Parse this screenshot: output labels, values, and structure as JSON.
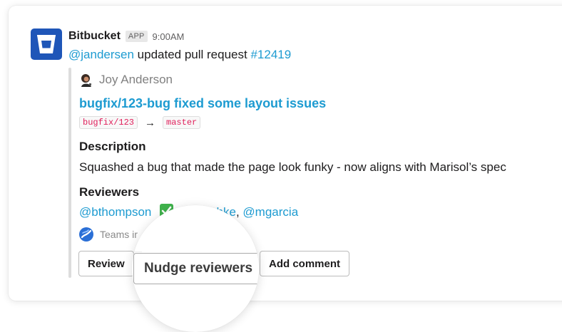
{
  "message": {
    "app_name": "Bitbucket",
    "app_badge": "APP",
    "time": "9:00AM",
    "actor": "@jandersen",
    "action_text": " updated pull request ",
    "pr_number": "#12419"
  },
  "attachment": {
    "author_name": "Joy Anderson",
    "pr_title": "bugfix/123-bug fixed some layout issues",
    "source_branch": "bugfix/123",
    "arrow": "→",
    "target_branch": "master",
    "description_label": "Description",
    "description_text": "Squashed a bug that made the page look funky - now aligns with Marisol’s spec",
    "reviewers_label": "Reviewers",
    "reviewer_1": "@bthompson",
    "reviewer_2_partial": "ntschke",
    "reviewer_separator": ", ",
    "reviewer_3": "@mgarcia",
    "teams_text": "Teams ir"
  },
  "actions": {
    "review_label": "Review",
    "nudge_label": "Nudge reviewers",
    "comment_label": "Add comment"
  },
  "colors": {
    "link": "#1d9bd1",
    "brand": "#1f56b8",
    "approved_check": "#3fb24c",
    "code_text": "#e01e5a"
  },
  "icons": {
    "logo": "bitbucket-logo-icon",
    "approved": "check-mark-icon",
    "teams": "teams-icon"
  }
}
